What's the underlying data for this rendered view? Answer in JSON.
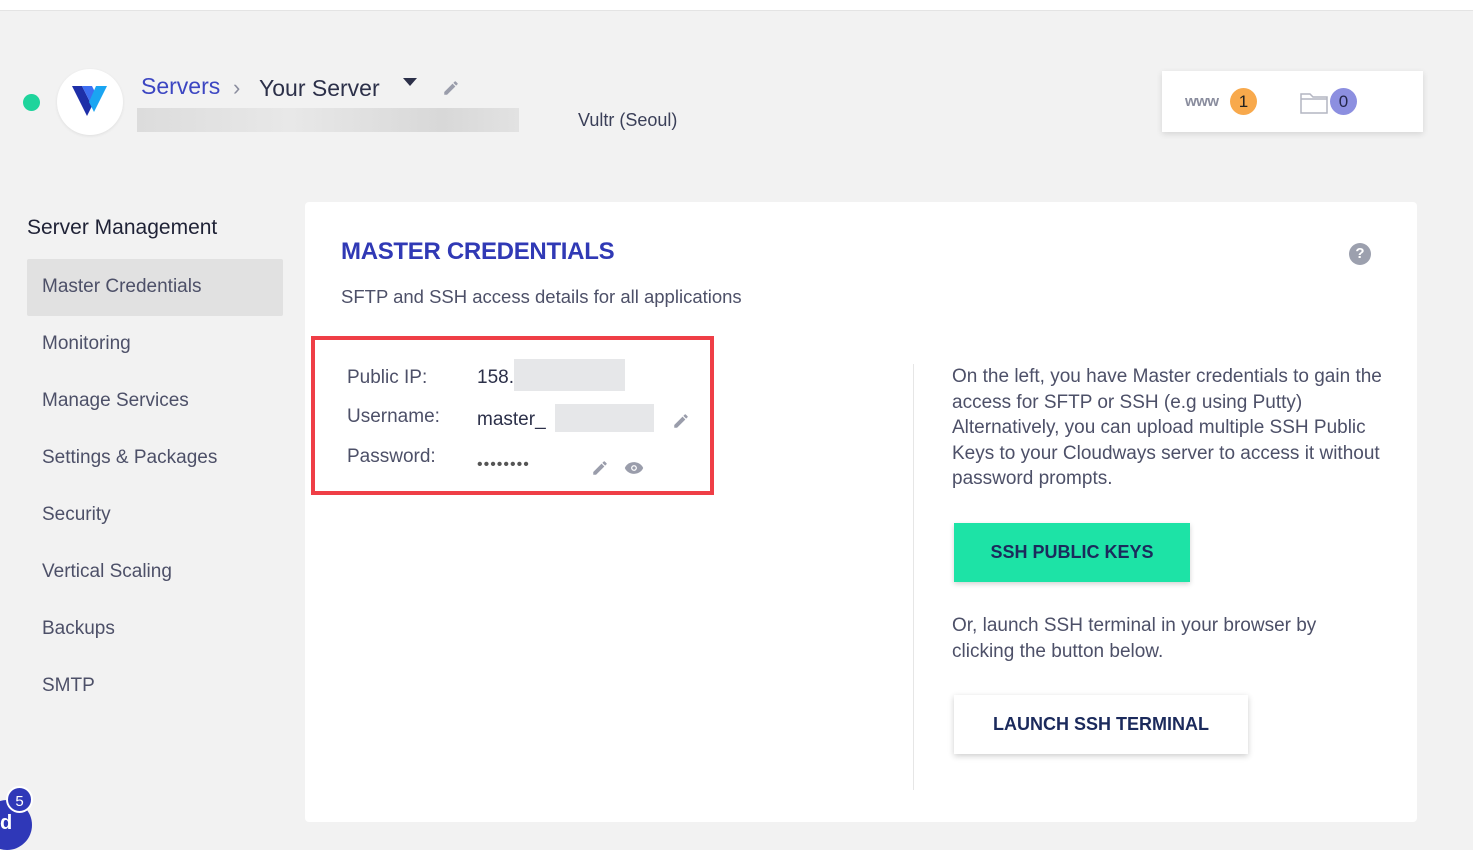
{
  "header": {
    "breadcrumb_servers": "Servers",
    "breadcrumb_separator": ">",
    "server_name": "Your Server",
    "provider": "Vultr (Seoul)",
    "status_color": "#1fd49c",
    "www_label": "www",
    "www_count": "1",
    "folder_count": "0"
  },
  "sidebar": {
    "title": "Server Management",
    "items": [
      {
        "label": "Master Credentials",
        "active": true
      },
      {
        "label": "Monitoring"
      },
      {
        "label": "Manage Services"
      },
      {
        "label": "Settings & Packages"
      },
      {
        "label": "Security"
      },
      {
        "label": "Vertical Scaling"
      },
      {
        "label": "Backups"
      },
      {
        "label": "SMTP"
      }
    ]
  },
  "main": {
    "title": "MASTER CREDENTIALS",
    "subtitle": "SFTP and SSH access details for all applications",
    "help": "?",
    "credentials": {
      "public_ip_label": "Public IP:",
      "public_ip_value": "158.",
      "username_label": "Username:",
      "username_value": "master_",
      "password_label": "Password:",
      "password_value": "••••••••"
    },
    "info_text": "On the left, you have Master credentials to gain the access for SFTP or SSH (e.g using Putty) Alternatively, you can upload multiple SSH Public Keys to your Cloudways server to access it without password prompts.",
    "ssh_keys_button": "SSH PUBLIC KEYS",
    "terminal_text": "Or, launch SSH terminal in your browser by clicking the button below.",
    "terminal_button": "LAUNCH SSH TERMINAL",
    "highlight_color": "#ef3e46",
    "accent_color": "#1de3a6"
  },
  "chat": {
    "badge": "5",
    "letter": "d"
  }
}
